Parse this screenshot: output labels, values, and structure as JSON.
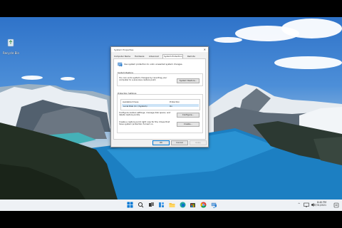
{
  "desktop": {
    "recycle_bin_label": "Recycle Bin"
  },
  "dialog": {
    "title": "System Properties",
    "close_glyph": "✕",
    "tabs": [
      "Computer Name",
      "Hardware",
      "Advanced",
      "System Protection",
      "Remote"
    ],
    "active_tab": "System Protection",
    "intro_text": "Use system protection to undo unwanted system changes.",
    "system_restore": {
      "heading": "System Restore",
      "description": "You can undo system changes by reverting your computer to a previous restore point.",
      "button": "System Restore..."
    },
    "protection_settings": {
      "heading": "Protection Settings",
      "columns": [
        "Available Drives",
        "Protection"
      ],
      "rows": [
        {
          "drive": "Local Disk (C:) (System)",
          "protection": "On"
        }
      ],
      "configure_text": "Configure restore settings, manage disk space, and delete restore points.",
      "configure_button": "Configure...",
      "create_text": "Create a restore point right now for the drives that have system protection turned on.",
      "create_button": "Create..."
    },
    "buttons": {
      "ok": "OK",
      "cancel": "Cancel",
      "apply": "Apply"
    }
  },
  "taskbar": {
    "icons": [
      "windows-start-icon",
      "search-icon",
      "task-view-icon",
      "widgets-icon",
      "file-explorer-icon",
      "edge-icon",
      "store-icon",
      "chrome-icon",
      "system-properties-icon"
    ],
    "tray_chevron": "^",
    "time": "8:40 PM",
    "date": "7/31/2021"
  },
  "colors": {
    "accent": "#0078d4",
    "taskbar": "#eef1f5",
    "dialog_bg": "#f0f0f0"
  }
}
